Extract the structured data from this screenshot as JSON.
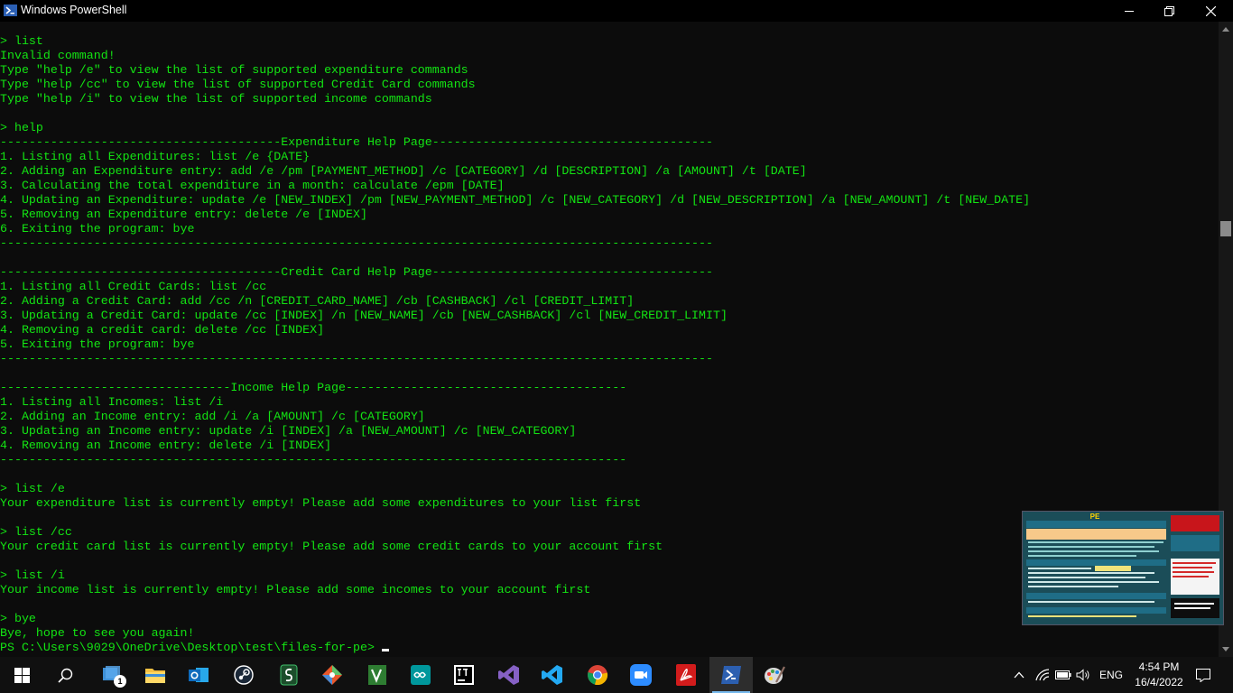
{
  "window": {
    "title": "Windows PowerShell"
  },
  "console": {
    "lines": [
      "> list",
      "Invalid command!",
      "Type \"help /e\" to view the list of supported expenditure commands",
      "Type \"help /cc\" to view the list of supported Credit Card commands",
      "Type \"help /i\" to view the list of supported income commands",
      "",
      "> help",
      "---------------------------------------Expenditure Help Page---------------------------------------",
      "1. Listing all Expenditures: list /e {DATE}",
      "2. Adding an Expenditure entry: add /e /pm [PAYMENT_METHOD] /c [CATEGORY] /d [DESCRIPTION] /a [AMOUNT] /t [DATE]",
      "3. Calculating the total expenditure in a month: calculate /epm [DATE]",
      "4. Updating an Expenditure: update /e [NEW_INDEX] /pm [NEW_PAYMENT_METHOD] /c [NEW_CATEGORY] /d [NEW_DESCRIPTION] /a [NEW_AMOUNT] /t [NEW_DATE]",
      "5. Removing an Expenditure entry: delete /e [INDEX]",
      "6. Exiting the program: bye",
      "---------------------------------------------------------------------------------------------------",
      "",
      "---------------------------------------Credit Card Help Page---------------------------------------",
      "1. Listing all Credit Cards: list /cc",
      "2. Adding a Credit Card: add /cc /n [CREDIT_CARD_NAME] /cb [CASHBACK] /cl [CREDIT_LIMIT]",
      "3. Updating a Credit Card: update /cc [INDEX] /n [NEW_NAME] /cb [NEW_CASHBACK] /cl [NEW_CREDIT_LIMIT]",
      "4. Removing a credit card: delete /cc [INDEX]",
      "5. Exiting the program: bye",
      "---------------------------------------------------------------------------------------------------",
      "",
      "--------------------------------Income Help Page---------------------------------------",
      "1. Listing all Incomes: list /i",
      "2. Adding an Income entry: add /i /a [AMOUNT] /c [CATEGORY]",
      "3. Updating an Income entry: update /i [INDEX] /a [NEW_AMOUNT] /c [NEW_CATEGORY]",
      "4. Removing an Income entry: delete /i [INDEX]",
      "---------------------------------------------------------------------------------------",
      "",
      "> list /e",
      "Your expenditure list is currently empty! Please add some expenditures to your list first",
      "",
      "> list /cc",
      "Your credit card list is currently empty! Please add some credit cards to your account first",
      "",
      "> list /i",
      "Your income list is currently empty! Please add some incomes to your account first",
      "",
      "> bye",
      "Bye, hope to see you again!"
    ],
    "prompt": "PS C:\\Users\\9029\\OneDrive\\Desktop\\test\\files-for-pe> "
  },
  "thumbnail": {
    "title": "PE"
  },
  "taskbar": {
    "tray": {
      "language": "ENG"
    },
    "clock": {
      "time": "4:54 PM",
      "date": "16/4/2022"
    },
    "explorer_badge": "1"
  },
  "colors": {
    "console_text": "#13e413",
    "console_bg": "#0c0c0c",
    "taskbar_bg": "#101010",
    "accent": "#76b9ed"
  }
}
